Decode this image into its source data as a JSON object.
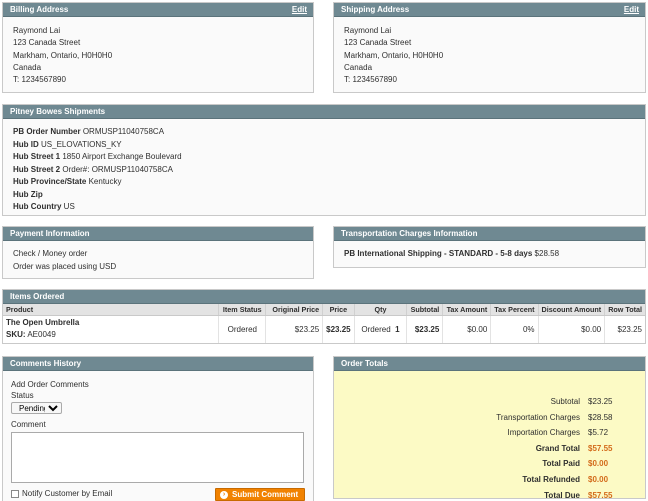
{
  "billing": {
    "title": "Billing Address",
    "edit": "Edit",
    "lines": [
      "Raymond Lai",
      "123 Canada Street",
      "Markham, Ontario, H0H0H0",
      "Canada",
      "T: 1234567890"
    ]
  },
  "shipping": {
    "title": "Shipping Address",
    "edit": "Edit",
    "lines": [
      "Raymond Lai",
      "123 Canada Street",
      "Markham, Ontario, H0H0H0",
      "Canada",
      "T: 1234567890"
    ]
  },
  "pitney": {
    "title": "Pitney Bowes Shipments",
    "rows": [
      {
        "label": "PB Order Number",
        "value": "ORMUSP11040758CA"
      },
      {
        "label": "Hub ID",
        "value": "US_ELOVATIONS_KY"
      },
      {
        "label": "Hub Street 1",
        "value": "1850 Airport Exchange Boulevard"
      },
      {
        "label": "Hub Street 2",
        "value": "Order#: ORMUSP11040758CA"
      },
      {
        "label": "Hub Province/State",
        "value": "Kentucky"
      },
      {
        "label": "Hub Zip",
        "value": ""
      },
      {
        "label": "Hub Country",
        "value": "US"
      }
    ]
  },
  "payment": {
    "title": "Payment Information",
    "method": "Check / Money order",
    "currency_note": "Order was placed using USD"
  },
  "transport": {
    "title": "Transportation Charges Information",
    "method": "PB International Shipping - STANDARD - 5-8 days",
    "price": "$28.58"
  },
  "items": {
    "title": "Items Ordered",
    "headers": {
      "product": "Product",
      "status": "Item Status",
      "orig": "Original Price",
      "price": "Price",
      "qty": "Qty",
      "subtotal": "Subtotal",
      "tax": "Tax Amount",
      "taxpct": "Tax Percent",
      "discount": "Discount Amount",
      "total": "Row Total"
    },
    "row": {
      "name": "The Open Umbrella",
      "sku_label": "SKU:",
      "sku": "AE0049",
      "status": "Ordered",
      "orig": "$23.25",
      "price": "$23.25",
      "qty_label": "Ordered",
      "qty": "1",
      "subtotal": "$23.25",
      "tax": "$0.00",
      "taxpct": "0%",
      "discount": "$0.00",
      "total": "$23.25"
    }
  },
  "comments": {
    "title": "Comments History",
    "add_label": "Add Order Comments",
    "status_label": "Status",
    "status_value": "Pending",
    "comment_label": "Comment",
    "notify_label": "Notify Customer by Email",
    "submit": "Submit Comment"
  },
  "totals": {
    "title": "Order Totals",
    "rows": [
      {
        "label": "Subtotal",
        "value": "$23.25"
      },
      {
        "label": "Transportation Charges",
        "value": "$28.58"
      },
      {
        "label": "Importation Charges",
        "value": "$5.72"
      },
      {
        "label": "Grand Total",
        "value": "$57.55"
      },
      {
        "label": "Total Paid",
        "value": "$0.00"
      },
      {
        "label": "Total Refunded",
        "value": "$0.00"
      },
      {
        "label": "Total Due",
        "value": "$57.55"
      }
    ]
  }
}
